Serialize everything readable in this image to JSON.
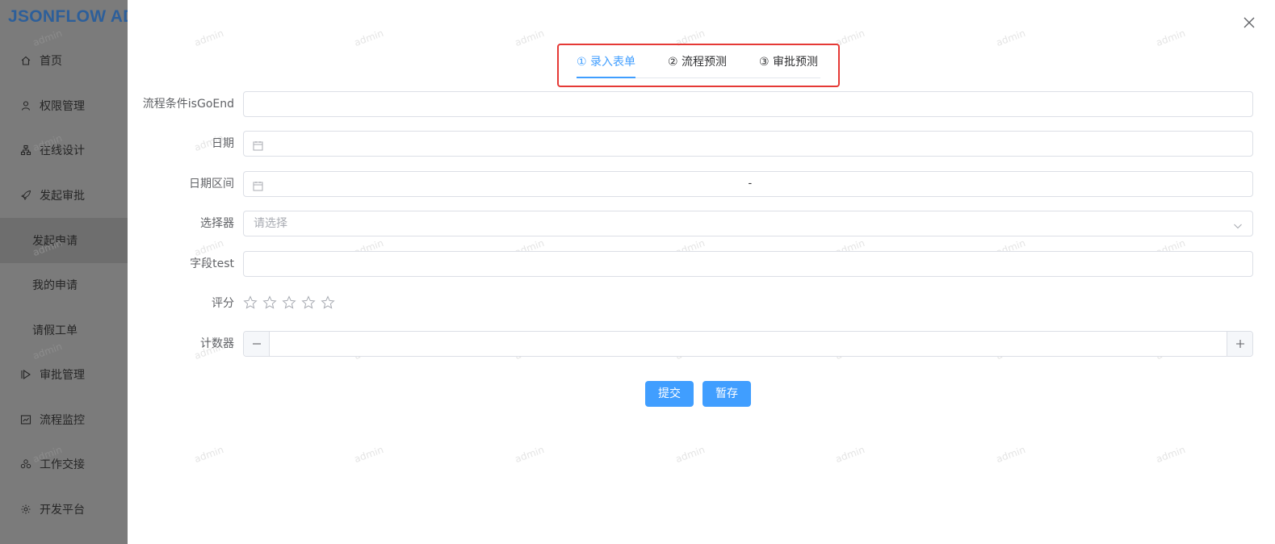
{
  "app": {
    "brand": "JSONFLOW AD"
  },
  "sidebar": {
    "items": [
      {
        "label": "首页",
        "icon": "home-icon"
      },
      {
        "label": "权限管理",
        "icon": "user-icon"
      },
      {
        "label": "在线设计",
        "icon": "org-chart-icon"
      },
      {
        "label": "发起审批",
        "icon": "rocket-icon"
      },
      {
        "label": "发起申请",
        "sub": true,
        "active": true
      },
      {
        "label": "我的申请",
        "sub": true
      },
      {
        "label": "请假工单",
        "sub": true
      },
      {
        "label": "审批管理",
        "icon": "play-icon"
      },
      {
        "label": "流程监控",
        "icon": "monitor-icon"
      },
      {
        "label": "工作交接",
        "icon": "handover-icon"
      },
      {
        "label": "开发平台",
        "icon": "gear-icon"
      }
    ]
  },
  "drawer": {
    "watermark_text": "admin",
    "steps": [
      {
        "label": "① 录入表单",
        "active": true
      },
      {
        "label": "② 流程预测",
        "active": false
      },
      {
        "label": "③ 审批预测",
        "active": false
      }
    ],
    "form": {
      "flow_condition": {
        "label": "流程条件isGoEnd",
        "value": ""
      },
      "date": {
        "label": "日期",
        "value": ""
      },
      "date_range": {
        "label": "日期区间",
        "separator": "-"
      },
      "selector": {
        "label": "选择器",
        "placeholder": "请选择"
      },
      "field_test": {
        "label": "字段test",
        "value": ""
      },
      "rating": {
        "label": "评分",
        "max": 5,
        "value": 0
      },
      "counter": {
        "label": "计数器",
        "value": ""
      }
    },
    "buttons": {
      "submit": "提交",
      "save_draft": "暂存"
    }
  },
  "colors": {
    "primary": "#409eff",
    "highlight_frame": "#e53935",
    "brand": "#2d5f9a",
    "overlay_sidebar": "#7b7b7b"
  }
}
